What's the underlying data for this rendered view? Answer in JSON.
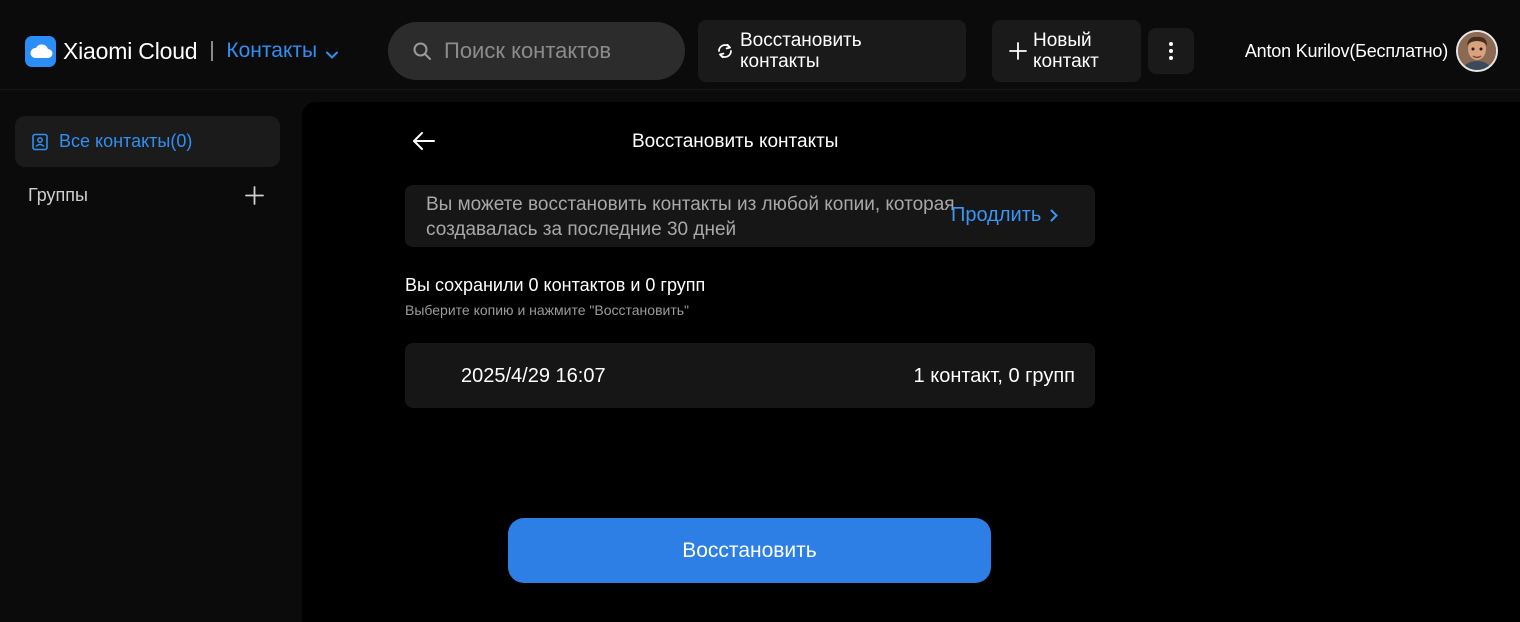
{
  "header": {
    "brand_name": "Xiaomi Cloud",
    "app_name": "Контакты",
    "search_placeholder": "Поиск контактов",
    "restore_button_label": "Восстановить контакты",
    "new_contact_label": "Новый контакт",
    "user_name": "Anton Kurilov(Бесплатно)"
  },
  "sidebar": {
    "all_contacts_label": "Все контакты(0)",
    "groups_label": "Группы"
  },
  "restore_panel": {
    "title": "Восстановить контакты",
    "info_text": "Вы можете восстановить контакты из любой копии, которая создавалась за последние 30 дней",
    "extend_link_label": "Продлить",
    "saved_summary": "Вы сохранили 0 контактов и 0 групп",
    "instruction": "Выберите копию и нажмите \"Восстановить\"",
    "backups": [
      {
        "date": "2025/4/29 16:07",
        "count_label": "1 контакт, 0 групп"
      }
    ],
    "restore_button_label": "Восстановить"
  },
  "colors": {
    "accent": "#2f8ff3",
    "primary_button": "#2d7fe6",
    "background": "#0b0b0b",
    "panel": "#000000",
    "card": "#161616"
  },
  "icons": {
    "brand": "cloud-icon",
    "app_switch": "chevron-down-icon",
    "search": "search-icon",
    "restore": "refresh-icon",
    "new_contact": "plus-icon",
    "more": "more-vertical-icon",
    "all_contacts": "contacts-book-icon",
    "add_group": "plus-icon",
    "back": "arrow-left-icon",
    "extend": "chevron-right-icon"
  }
}
